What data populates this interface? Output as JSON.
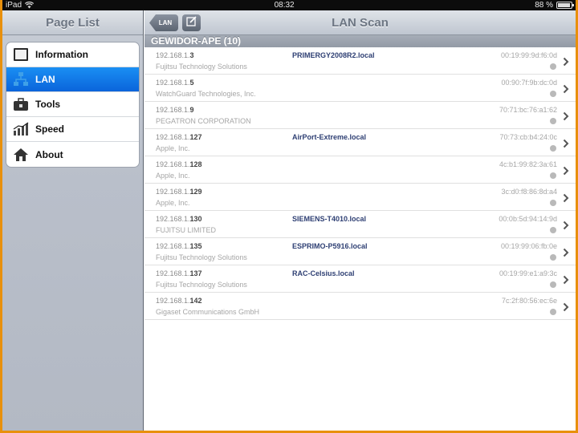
{
  "statusbar": {
    "device": "iPad",
    "time": "08:32",
    "battery": "88 %"
  },
  "master": {
    "title": "Page List",
    "items": [
      {
        "label": "Information",
        "icon": "information-icon"
      },
      {
        "label": "LAN",
        "icon": "network-icon",
        "selected": true
      },
      {
        "label": "Tools",
        "icon": "toolbox-icon"
      },
      {
        "label": "Speed",
        "icon": "bar-chart-icon"
      },
      {
        "label": "About",
        "icon": "house-icon"
      }
    ]
  },
  "detail": {
    "title": "LAN Scan",
    "back_label": "LAN",
    "section": "GEWIDOR-APE (10)",
    "rows": [
      {
        "ip_prefix": "192.168.1.",
        "ip_suffix": "3",
        "vendor": "Fujitsu Technology Solutions",
        "host": "PRIMERGY2008R2.local",
        "mac": "00:19:99:9d:f6:0d"
      },
      {
        "ip_prefix": "192.168.1.",
        "ip_suffix": "5",
        "vendor": "WatchGuard Technologies, Inc.",
        "host": "",
        "mac": "00:90:7f:9b:dc:0d"
      },
      {
        "ip_prefix": "192.168.1.",
        "ip_suffix": "9",
        "vendor": "PEGATRON CORPORATION",
        "host": "",
        "mac": "70:71:bc:76:a1:62"
      },
      {
        "ip_prefix": "192.168.1.",
        "ip_suffix": "127",
        "vendor": "Apple, Inc.",
        "host": "AirPort-Extreme.local",
        "mac": "70:73:cb:b4:24:0c"
      },
      {
        "ip_prefix": "192.168.1.",
        "ip_suffix": "128",
        "vendor": "Apple, Inc.",
        "host": "",
        "mac": "4c:b1:99:82:3a:61"
      },
      {
        "ip_prefix": "192.168.1.",
        "ip_suffix": "129",
        "vendor": "Apple, Inc.",
        "host": "",
        "mac": "3c:d0:f8:86:8d:a4"
      },
      {
        "ip_prefix": "192.168.1.",
        "ip_suffix": "130",
        "vendor": "FUJITSU LIMITED",
        "host": "SIEMENS-T4010.local",
        "mac": "00:0b:5d:94:14:9d"
      },
      {
        "ip_prefix": "192.168.1.",
        "ip_suffix": "135",
        "vendor": "Fujitsu Technology Solutions",
        "host": "ESPRIMO-P5916.local",
        "mac": "00:19:99:06:fb:0e"
      },
      {
        "ip_prefix": "192.168.1.",
        "ip_suffix": "137",
        "vendor": "Fujitsu Technology Solutions",
        "host": "RAC-Celsius.local",
        "mac": "00:19:99:e1:a9:3c"
      },
      {
        "ip_prefix": "192.168.1.",
        "ip_suffix": "142",
        "vendor": "Gigaset Communications GmbH",
        "host": "",
        "mac": "7c:2f:80:56:ec:6e"
      }
    ]
  },
  "colors": {
    "selected": "#0a64db",
    "host_text": "#2e3f73",
    "frame": "#e8900c"
  }
}
